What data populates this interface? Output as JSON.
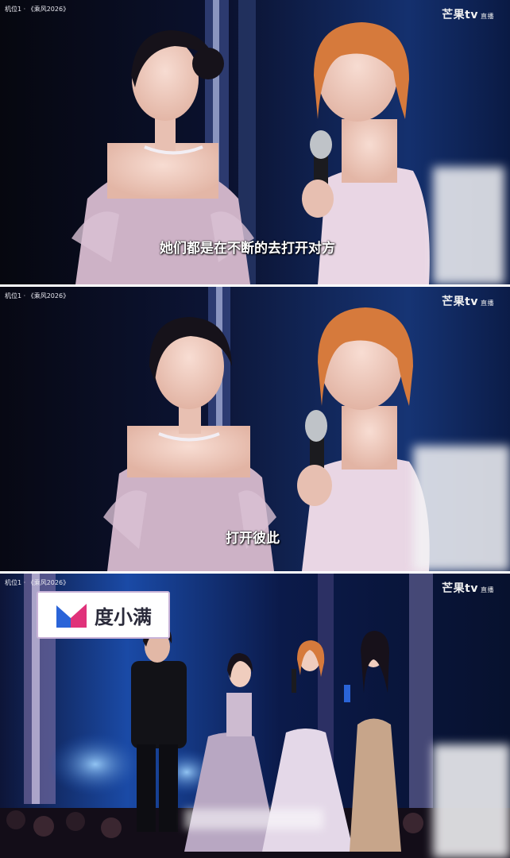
{
  "panels": [
    {
      "channel": "机位1 · 《乘风2026》",
      "logo": "芒果tv",
      "logo_sub": "直播",
      "subtitle": "她们都是在不断的去打开对方"
    },
    {
      "channel": "机位1 · 《乘风2026》",
      "logo": "芒果tv",
      "logo_sub": "直播",
      "subtitle": "打开彼此"
    },
    {
      "channel": "机位1 · 《乘风2026》",
      "logo": "芒果tv",
      "logo_sub": "直播",
      "sponsor": "度小满"
    }
  ],
  "colors": {
    "stage_bg": "#0b1026",
    "stage_blue": "#1c4fa8",
    "dress_lilac": "#c9b0c4",
    "hair_orange": "#d77a3c",
    "sponsor_magenta": "#e0327a",
    "sponsor_blue": "#2a64d8"
  }
}
